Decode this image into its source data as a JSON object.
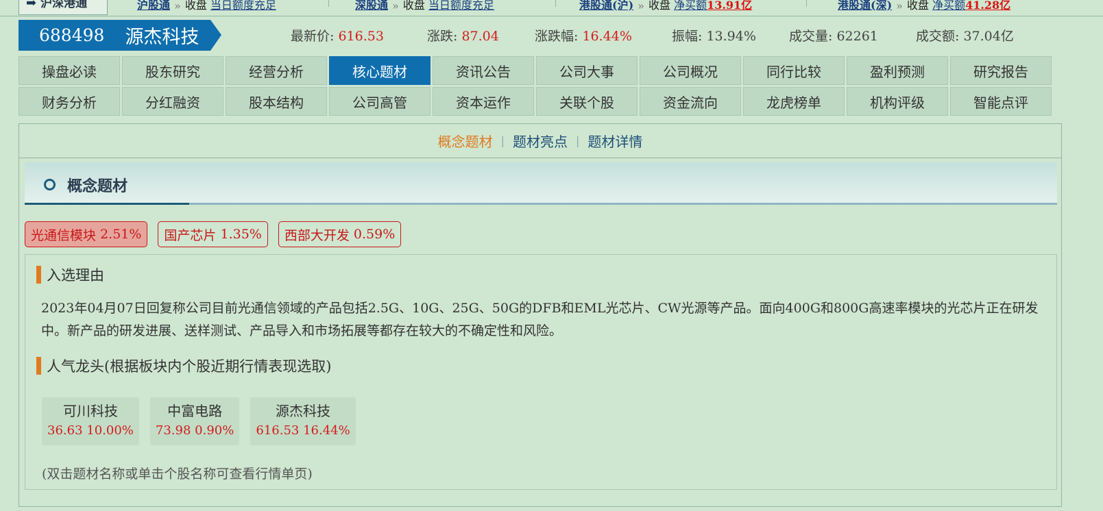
{
  "top_strip": {
    "brand": "沪深港通",
    "segments": [
      {
        "link": "沪股通",
        "text": "收盘",
        "tail": "当日额度充足"
      },
      {
        "link": "深股通",
        "text": "收盘",
        "tail": "当日额度充足"
      },
      {
        "link": "港股通(沪)",
        "text": "收盘",
        "tail": "净买额",
        "amount": "13.91亿"
      },
      {
        "link": "港股通(深)",
        "text": "收盘",
        "tail": "净买额",
        "amount": "41.28亿"
      }
    ]
  },
  "stock": {
    "code": "688498",
    "name": "源杰科技",
    "quotes": [
      {
        "label": "最新价:",
        "value": "616.53",
        "red": true
      },
      {
        "label": "涨跌:",
        "value": "87.04",
        "red": true
      },
      {
        "label": "涨跌幅:",
        "value": "16.44%",
        "red": true
      },
      {
        "label": "振幅:",
        "value": "13.94%",
        "red": false
      },
      {
        "label": "成交量:",
        "value": "62261",
        "red": false
      },
      {
        "label": "成交额:",
        "value": "37.04亿",
        "red": false
      }
    ]
  },
  "nav": {
    "row1": [
      "操盘必读",
      "股东研究",
      "经营分析",
      "核心题材",
      "资讯公告",
      "公司大事",
      "公司概况",
      "同行比较",
      "盈利预测",
      "研究报告"
    ],
    "row2": [
      "财务分析",
      "分红融资",
      "股本结构",
      "公司高管",
      "资本运作",
      "关联个股",
      "资金流向",
      "龙虎榜单",
      "机构评级",
      "智能点评"
    ],
    "active": "核心题材"
  },
  "subtabs": [
    "概念题材",
    "题材亮点",
    "题材详情"
  ],
  "section": {
    "title": "概念题材",
    "tags": [
      {
        "name": "光通信模块",
        "pct": "2.51%",
        "active": true
      },
      {
        "name": "国产芯片",
        "pct": "1.35%",
        "active": false
      },
      {
        "name": "西部大开发",
        "pct": "0.59%",
        "active": false
      }
    ],
    "reason_title": "入选理由",
    "reason_text": "2023年04月07日回复称公司目前光通信领域的产品包括2.5G、10G、25G、50G的DFB和EML光芯片、CW光源等产品。面向400G和800G高速率模块的光芯片正在研发中。新产品的研发进展、送样测试、产品导入和市场拓展等都存在较大的不确定性和风险。",
    "leaders_title": "人气龙头(根据板块内个股近期行情表现选取)",
    "leaders": [
      {
        "name": "可川科技",
        "price": "36.63",
        "pct": "10.00%"
      },
      {
        "name": "中富电路",
        "price": "73.98",
        "pct": "0.90%"
      },
      {
        "name": "源杰科技",
        "price": "616.53",
        "pct": "16.44%"
      }
    ],
    "hint": "(双击题材名称或单击个股名称可查看行情单页)"
  }
}
